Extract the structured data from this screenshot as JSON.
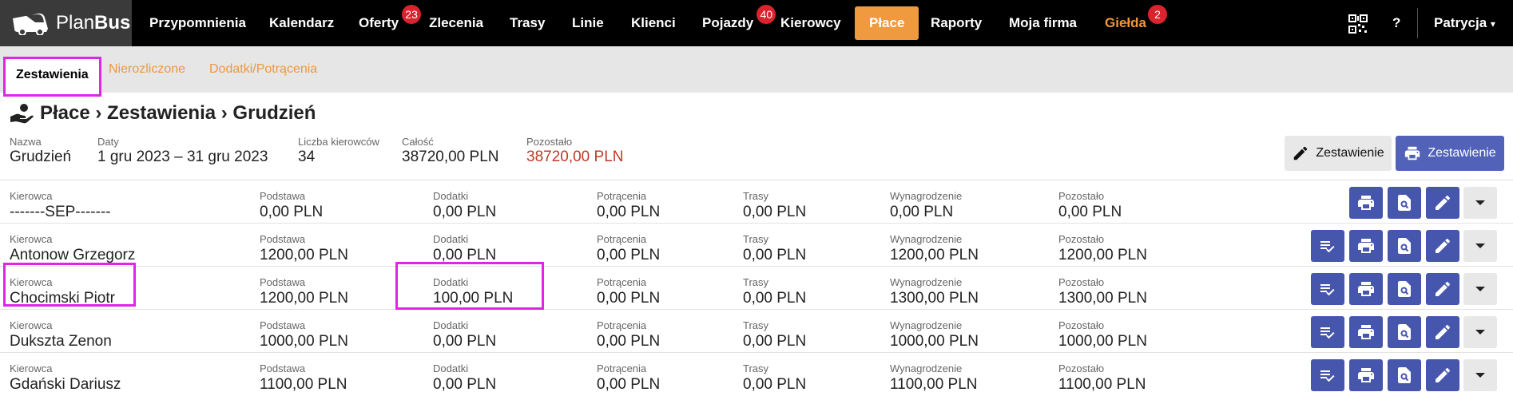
{
  "brand": {
    "plan": "Plan",
    "bus": "Bus"
  },
  "nav": [
    {
      "label": "Przypomnienia"
    },
    {
      "label": "Kalendarz"
    },
    {
      "label": "Oferty",
      "badge": "23"
    },
    {
      "label": "Zlecenia"
    },
    {
      "label": "Trasy"
    },
    {
      "label": "Linie"
    },
    {
      "label": "Klienci"
    },
    {
      "label": "Pojazdy",
      "badge": "40"
    },
    {
      "label": "Kierowcy"
    },
    {
      "label": "Płace",
      "active": true
    },
    {
      "label": "Raporty"
    },
    {
      "label": "Moja firma"
    },
    {
      "label": "Giełda",
      "badge": "2"
    }
  ],
  "nav_right": {
    "help": "?",
    "user": "Patrycja",
    "caret": "▾"
  },
  "tabs": [
    {
      "label": "Zestawienia"
    },
    {
      "label": "Nierozliczone"
    },
    {
      "label": "Dodatki/Potrącenia"
    }
  ],
  "page_title": "Płace › Zestawienia › Grudzień",
  "summary": {
    "name_label": "Nazwa",
    "name": "Grudzień",
    "dates_label": "Daty",
    "dates": "1 gru 2023 – 31 gru 2023",
    "drivers_label": "Liczba kierowców",
    "drivers": "34",
    "total_label": "Całość",
    "total": "38720,00 PLN",
    "remaining_label": "Pozostało",
    "remaining": "38720,00 PLN"
  },
  "buttons": {
    "edit": "Zestawienie",
    "print": "Zestawienie"
  },
  "columns": {
    "driver": "Kierowca",
    "base": "Podstawa",
    "extras": "Dodatki",
    "deductions": "Potrącenia",
    "routes": "Trasy",
    "salary": "Wynagrodzenie",
    "remaining": "Pozostało"
  },
  "rows": [
    {
      "driver": "-------SEP-------",
      "base": "0,00 PLN",
      "extras": "0,00 PLN",
      "deductions": "0,00 PLN",
      "routes": "0,00 PLN",
      "salary": "0,00 PLN",
      "remaining": "0,00 PLN"
    },
    {
      "driver": "Antonow Grzegorz",
      "base": "1200,00 PLN",
      "extras": "0,00 PLN",
      "deductions": "0,00 PLN",
      "routes": "0,00 PLN",
      "salary": "1200,00 PLN",
      "remaining": "1200,00 PLN"
    },
    {
      "driver": "Chocimski Piotr",
      "base": "1200,00 PLN",
      "extras": "100,00 PLN",
      "deductions": "0,00 PLN",
      "routes": "0,00 PLN",
      "salary": "1300,00 PLN",
      "remaining": "1300,00 PLN"
    },
    {
      "driver": "Dukszta Zenon",
      "base": "1000,00 PLN",
      "extras": "0,00 PLN",
      "deductions": "0,00 PLN",
      "routes": "0,00 PLN",
      "salary": "1000,00 PLN",
      "remaining": "1000,00 PLN"
    },
    {
      "driver": "Gdański Dariusz",
      "base": "1100,00 PLN",
      "extras": "0,00 PLN",
      "deductions": "0,00 PLN",
      "routes": "0,00 PLN",
      "salary": "1100,00 PLN",
      "remaining": "1100,00 PLN"
    }
  ],
  "colors": {
    "accent": "#ef9a3f",
    "primary_button": "#4656ad",
    "highlight": "#e024e8",
    "negative": "#c0392b"
  }
}
